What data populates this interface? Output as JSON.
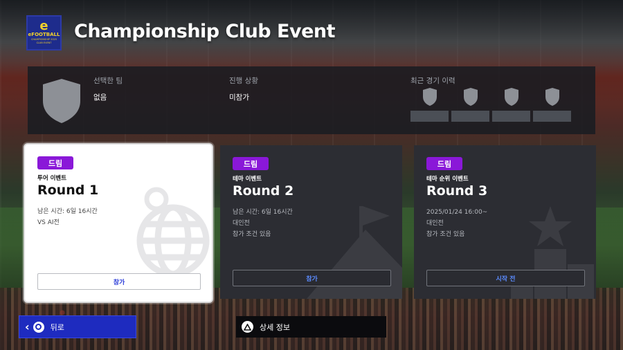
{
  "header": {
    "logo_text": "eFOOTBALL",
    "logo_sub": "CHAMPIONSHIP 2025 CLUB EVENT",
    "title": "Championship Club Event"
  },
  "info": {
    "selected_team_label": "선택한 팀",
    "selected_team_value": "없음",
    "progress_label": "진행 상황",
    "progress_value": "미참가",
    "recent_label": "최근 경기 이력"
  },
  "cards": [
    {
      "badge": "드림",
      "type": "투어 이벤트",
      "round": "Round 1",
      "details": [
        "남은 시간: 6일 16시간",
        "VS AI전"
      ],
      "action": "참가"
    },
    {
      "badge": "드림",
      "type": "테마 이벤트",
      "round": "Round 2",
      "details": [
        "남은 시간: 6일 16시간",
        "대인전",
        "참가 조건 있음"
      ],
      "action": "참가"
    },
    {
      "badge": "드림",
      "type": "테마 순위 이벤트",
      "round": "Round 3",
      "details": [
        "2025/01/24 16:00~",
        "대인전",
        "참가 조건 있음"
      ],
      "action": "시작 전"
    }
  ],
  "footer": {
    "back_label": "뒤로",
    "detail_label": "상세 정보"
  },
  "colors": {
    "badge_purple": "#8a18d8",
    "back_blue": "#1e2bbf",
    "action_blue": "#2a3bd8"
  }
}
